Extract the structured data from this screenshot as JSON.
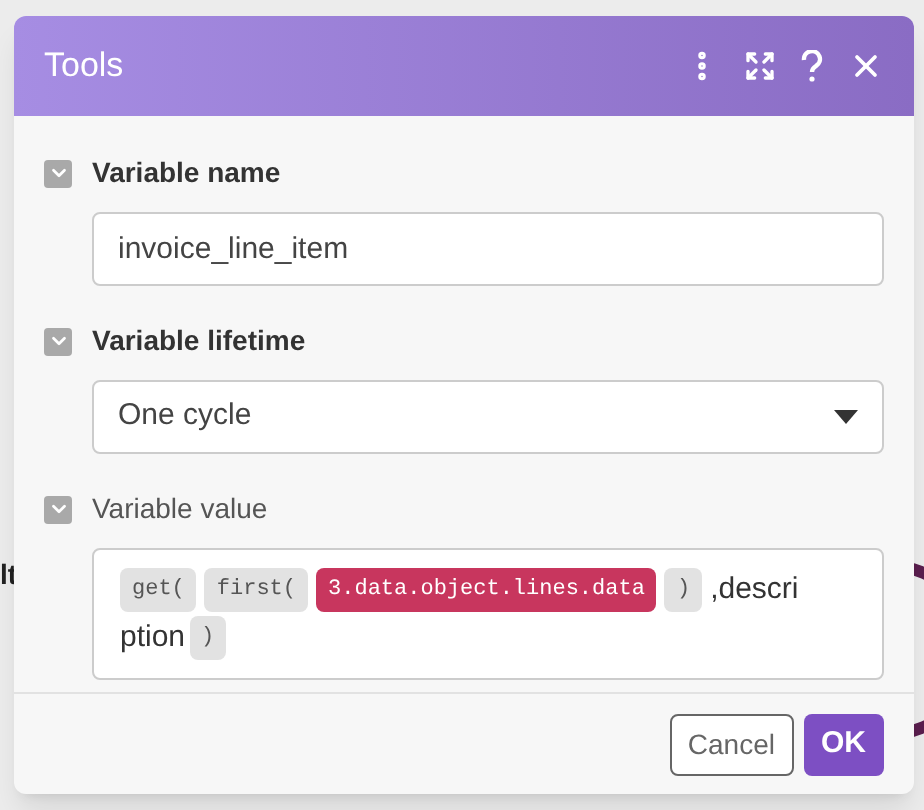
{
  "background": {
    "label": "lt"
  },
  "dialog": {
    "title": "Tools",
    "fields": [
      {
        "label": "Variable name",
        "required": true,
        "kind": "text",
        "value": "invoice_line_item"
      },
      {
        "label": "Variable lifetime",
        "required": true,
        "kind": "select",
        "value": "One cycle"
      },
      {
        "label": "Variable value",
        "required": false,
        "kind": "formula",
        "tokens": [
          {
            "kind": "function",
            "text": "get("
          },
          {
            "kind": "function",
            "text": "first("
          },
          {
            "kind": "variable",
            "text": "3.data.object.lines.data"
          },
          {
            "kind": "function",
            "text": ")"
          },
          {
            "kind": "text",
            "text": ",descri"
          },
          {
            "kind": "text",
            "text": "ption"
          },
          {
            "kind": "function",
            "text": ")"
          }
        ]
      }
    ],
    "buttons": [
      {
        "label": "Cancel",
        "primary": false
      },
      {
        "label": "OK",
        "primary": true
      }
    ]
  }
}
